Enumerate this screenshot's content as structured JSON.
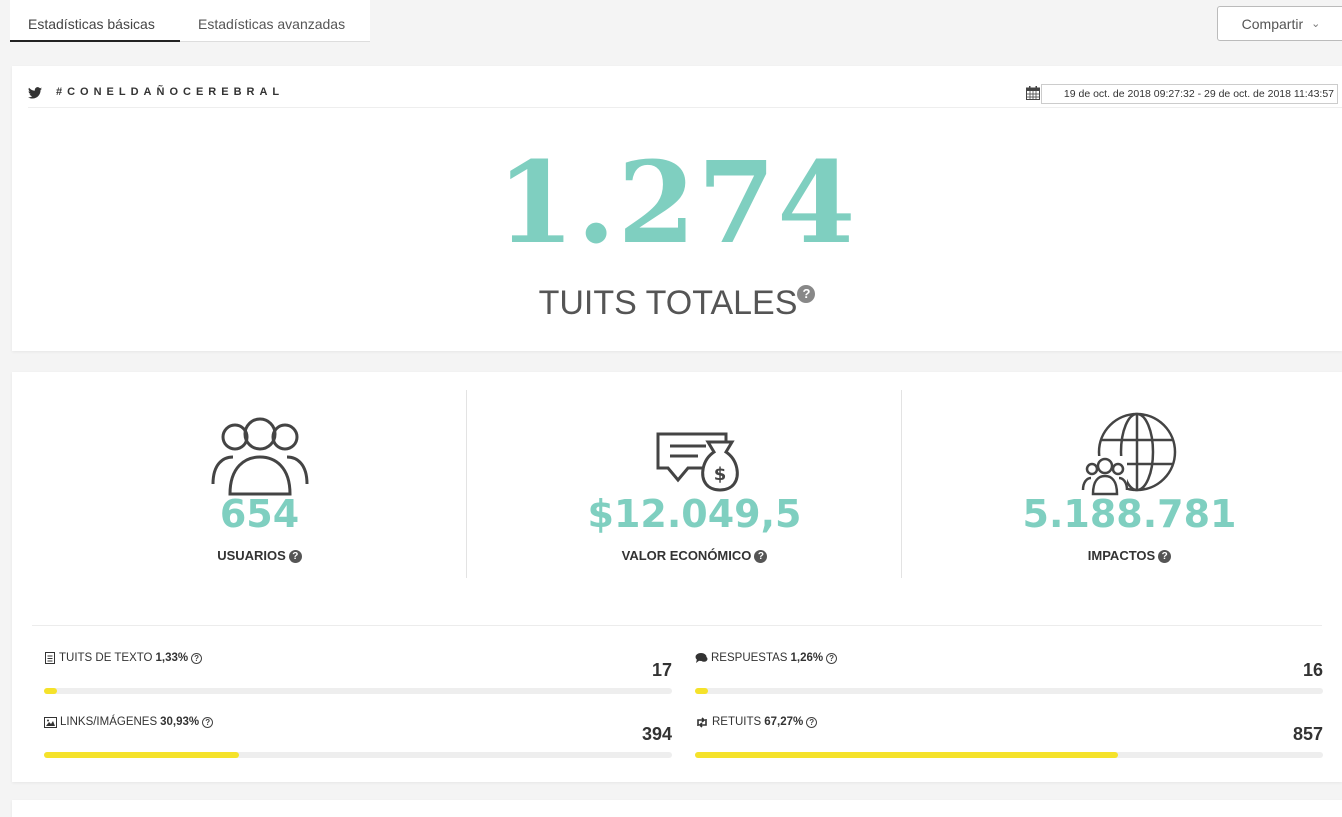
{
  "tabs": {
    "basic": "Estadísticas básicas",
    "advanced": "Estadísticas avanzadas"
  },
  "share": {
    "label": "Compartir"
  },
  "header": {
    "hashtag": "#CONELDAÑOCEREBRAL",
    "date_range": "19 de oct. de 2018 09:27:32 - 29 de oct. de 2018 11:43:57"
  },
  "total": {
    "value": "1.274",
    "label": "TUITS TOTALES",
    "help": "?"
  },
  "stats": [
    {
      "icon": "users-icon",
      "value": "654",
      "label": "USUARIOS"
    },
    {
      "icon": "money-bag-ticket-icon",
      "value": "$12.049,5",
      "label": "VALOR ECONÓMICO"
    },
    {
      "icon": "globe-users-icon",
      "value": "5.188.781",
      "label": "IMPACTOS"
    }
  ],
  "metrics": [
    {
      "icon": "document-icon",
      "label": "TUITS DE TEXTO",
      "percent_text": "1,33%",
      "value": "17",
      "fill_percent": 2
    },
    {
      "icon": "comments-icon",
      "label": "RESPUESTAS",
      "percent_text": "1,26%",
      "value": "16",
      "fill_percent": 2
    },
    {
      "icon": "image-icon",
      "label": "LINKS/IMÁGENES",
      "percent_text": "30,93%",
      "value": "394",
      "fill_percent": 31
    },
    {
      "icon": "retweet-icon",
      "label": "RETUITS",
      "percent_text": "67,27%",
      "value": "857",
      "fill_percent": 67.3
    }
  ],
  "colors": {
    "accent": "#7fcfc0",
    "bar": "#f5e22a"
  }
}
